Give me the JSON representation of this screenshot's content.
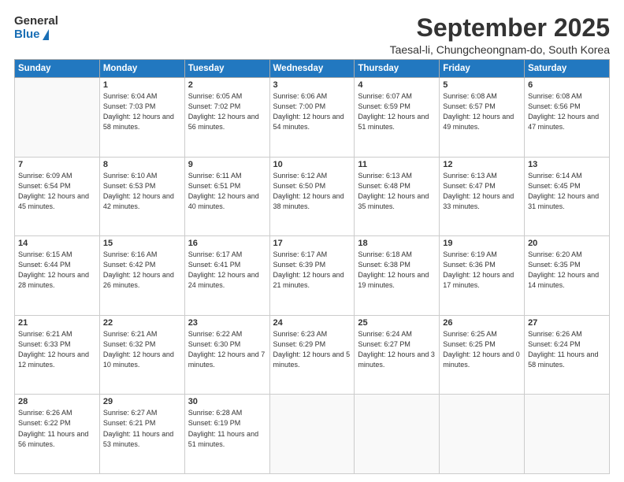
{
  "header": {
    "logo": {
      "general": "General",
      "blue": "Blue"
    },
    "title": "September 2025",
    "location": "Taesal-li, Chungcheongnam-do, South Korea"
  },
  "days_of_week": [
    "Sunday",
    "Monday",
    "Tuesday",
    "Wednesday",
    "Thursday",
    "Friday",
    "Saturday"
  ],
  "weeks": [
    [
      {
        "num": "",
        "sunrise": "",
        "sunset": "",
        "daylight": ""
      },
      {
        "num": "1",
        "sunrise": "Sunrise: 6:04 AM",
        "sunset": "Sunset: 7:03 PM",
        "daylight": "Daylight: 12 hours and 58 minutes."
      },
      {
        "num": "2",
        "sunrise": "Sunrise: 6:05 AM",
        "sunset": "Sunset: 7:02 PM",
        "daylight": "Daylight: 12 hours and 56 minutes."
      },
      {
        "num": "3",
        "sunrise": "Sunrise: 6:06 AM",
        "sunset": "Sunset: 7:00 PM",
        "daylight": "Daylight: 12 hours and 54 minutes."
      },
      {
        "num": "4",
        "sunrise": "Sunrise: 6:07 AM",
        "sunset": "Sunset: 6:59 PM",
        "daylight": "Daylight: 12 hours and 51 minutes."
      },
      {
        "num": "5",
        "sunrise": "Sunrise: 6:08 AM",
        "sunset": "Sunset: 6:57 PM",
        "daylight": "Daylight: 12 hours and 49 minutes."
      },
      {
        "num": "6",
        "sunrise": "Sunrise: 6:08 AM",
        "sunset": "Sunset: 6:56 PM",
        "daylight": "Daylight: 12 hours and 47 minutes."
      }
    ],
    [
      {
        "num": "7",
        "sunrise": "Sunrise: 6:09 AM",
        "sunset": "Sunset: 6:54 PM",
        "daylight": "Daylight: 12 hours and 45 minutes."
      },
      {
        "num": "8",
        "sunrise": "Sunrise: 6:10 AM",
        "sunset": "Sunset: 6:53 PM",
        "daylight": "Daylight: 12 hours and 42 minutes."
      },
      {
        "num": "9",
        "sunrise": "Sunrise: 6:11 AM",
        "sunset": "Sunset: 6:51 PM",
        "daylight": "Daylight: 12 hours and 40 minutes."
      },
      {
        "num": "10",
        "sunrise": "Sunrise: 6:12 AM",
        "sunset": "Sunset: 6:50 PM",
        "daylight": "Daylight: 12 hours and 38 minutes."
      },
      {
        "num": "11",
        "sunrise": "Sunrise: 6:13 AM",
        "sunset": "Sunset: 6:48 PM",
        "daylight": "Daylight: 12 hours and 35 minutes."
      },
      {
        "num": "12",
        "sunrise": "Sunrise: 6:13 AM",
        "sunset": "Sunset: 6:47 PM",
        "daylight": "Daylight: 12 hours and 33 minutes."
      },
      {
        "num": "13",
        "sunrise": "Sunrise: 6:14 AM",
        "sunset": "Sunset: 6:45 PM",
        "daylight": "Daylight: 12 hours and 31 minutes."
      }
    ],
    [
      {
        "num": "14",
        "sunrise": "Sunrise: 6:15 AM",
        "sunset": "Sunset: 6:44 PM",
        "daylight": "Daylight: 12 hours and 28 minutes."
      },
      {
        "num": "15",
        "sunrise": "Sunrise: 6:16 AM",
        "sunset": "Sunset: 6:42 PM",
        "daylight": "Daylight: 12 hours and 26 minutes."
      },
      {
        "num": "16",
        "sunrise": "Sunrise: 6:17 AM",
        "sunset": "Sunset: 6:41 PM",
        "daylight": "Daylight: 12 hours and 24 minutes."
      },
      {
        "num": "17",
        "sunrise": "Sunrise: 6:17 AM",
        "sunset": "Sunset: 6:39 PM",
        "daylight": "Daylight: 12 hours and 21 minutes."
      },
      {
        "num": "18",
        "sunrise": "Sunrise: 6:18 AM",
        "sunset": "Sunset: 6:38 PM",
        "daylight": "Daylight: 12 hours and 19 minutes."
      },
      {
        "num": "19",
        "sunrise": "Sunrise: 6:19 AM",
        "sunset": "Sunset: 6:36 PM",
        "daylight": "Daylight: 12 hours and 17 minutes."
      },
      {
        "num": "20",
        "sunrise": "Sunrise: 6:20 AM",
        "sunset": "Sunset: 6:35 PM",
        "daylight": "Daylight: 12 hours and 14 minutes."
      }
    ],
    [
      {
        "num": "21",
        "sunrise": "Sunrise: 6:21 AM",
        "sunset": "Sunset: 6:33 PM",
        "daylight": "Daylight: 12 hours and 12 minutes."
      },
      {
        "num": "22",
        "sunrise": "Sunrise: 6:21 AM",
        "sunset": "Sunset: 6:32 PM",
        "daylight": "Daylight: 12 hours and 10 minutes."
      },
      {
        "num": "23",
        "sunrise": "Sunrise: 6:22 AM",
        "sunset": "Sunset: 6:30 PM",
        "daylight": "Daylight: 12 hours and 7 minutes."
      },
      {
        "num": "24",
        "sunrise": "Sunrise: 6:23 AM",
        "sunset": "Sunset: 6:29 PM",
        "daylight": "Daylight: 12 hours and 5 minutes."
      },
      {
        "num": "25",
        "sunrise": "Sunrise: 6:24 AM",
        "sunset": "Sunset: 6:27 PM",
        "daylight": "Daylight: 12 hours and 3 minutes."
      },
      {
        "num": "26",
        "sunrise": "Sunrise: 6:25 AM",
        "sunset": "Sunset: 6:25 PM",
        "daylight": "Daylight: 12 hours and 0 minutes."
      },
      {
        "num": "27",
        "sunrise": "Sunrise: 6:26 AM",
        "sunset": "Sunset: 6:24 PM",
        "daylight": "Daylight: 11 hours and 58 minutes."
      }
    ],
    [
      {
        "num": "28",
        "sunrise": "Sunrise: 6:26 AM",
        "sunset": "Sunset: 6:22 PM",
        "daylight": "Daylight: 11 hours and 56 minutes."
      },
      {
        "num": "29",
        "sunrise": "Sunrise: 6:27 AM",
        "sunset": "Sunset: 6:21 PM",
        "daylight": "Daylight: 11 hours and 53 minutes."
      },
      {
        "num": "30",
        "sunrise": "Sunrise: 6:28 AM",
        "sunset": "Sunset: 6:19 PM",
        "daylight": "Daylight: 11 hours and 51 minutes."
      },
      {
        "num": "",
        "sunrise": "",
        "sunset": "",
        "daylight": ""
      },
      {
        "num": "",
        "sunrise": "",
        "sunset": "",
        "daylight": ""
      },
      {
        "num": "",
        "sunrise": "",
        "sunset": "",
        "daylight": ""
      },
      {
        "num": "",
        "sunrise": "",
        "sunset": "",
        "daylight": ""
      }
    ]
  ]
}
